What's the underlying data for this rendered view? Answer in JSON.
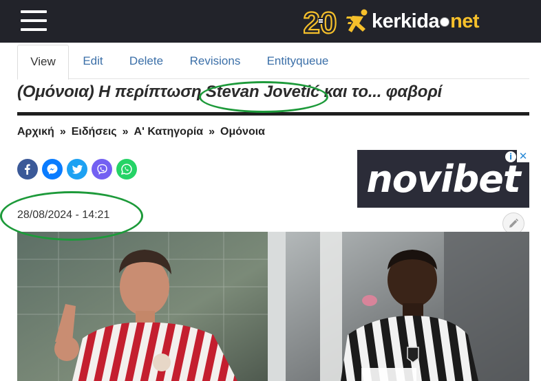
{
  "header": {
    "menu_icon": "hamburger-menu-icon",
    "badge_text": "20",
    "logo_part1": "kerkida",
    "logo_part2": "net",
    "logo_colors": {
      "accent": "#f6c02b",
      "bg": "#22232a"
    }
  },
  "tabs": [
    {
      "label": "View",
      "active": true
    },
    {
      "label": "Edit",
      "active": false
    },
    {
      "label": "Delete",
      "active": false
    },
    {
      "label": "Revisions",
      "active": false
    },
    {
      "label": "Entityqueue",
      "active": false
    }
  ],
  "article": {
    "title_prefix": "(Ομόνοια) Η περίπτωση ",
    "title_highlight": "Stevan Jovetić",
    "title_suffix": " και το... φαβορί",
    "date": "28/08/2024 - 14:21"
  },
  "breadcrumb": [
    {
      "label": "Αρχική"
    },
    {
      "label": "Ειδήσεις"
    },
    {
      "label": "Α' Κατηγορία"
    },
    {
      "label": "Ομόνοια"
    }
  ],
  "breadcrumb_sep": "»",
  "share": [
    {
      "icon": "facebook-icon",
      "color": "#3b5998"
    },
    {
      "icon": "messenger-icon",
      "color": "#0a7cff"
    },
    {
      "icon": "twitter-icon",
      "color": "#1da1f2"
    },
    {
      "icon": "viber-icon",
      "color": "#7360f2"
    },
    {
      "icon": "whatsapp-icon",
      "color": "#25d366"
    }
  ],
  "ad": {
    "text": "novibet",
    "info_glyph": "i",
    "close_glyph": "✕"
  },
  "annotation_color": "#1d9a3a"
}
